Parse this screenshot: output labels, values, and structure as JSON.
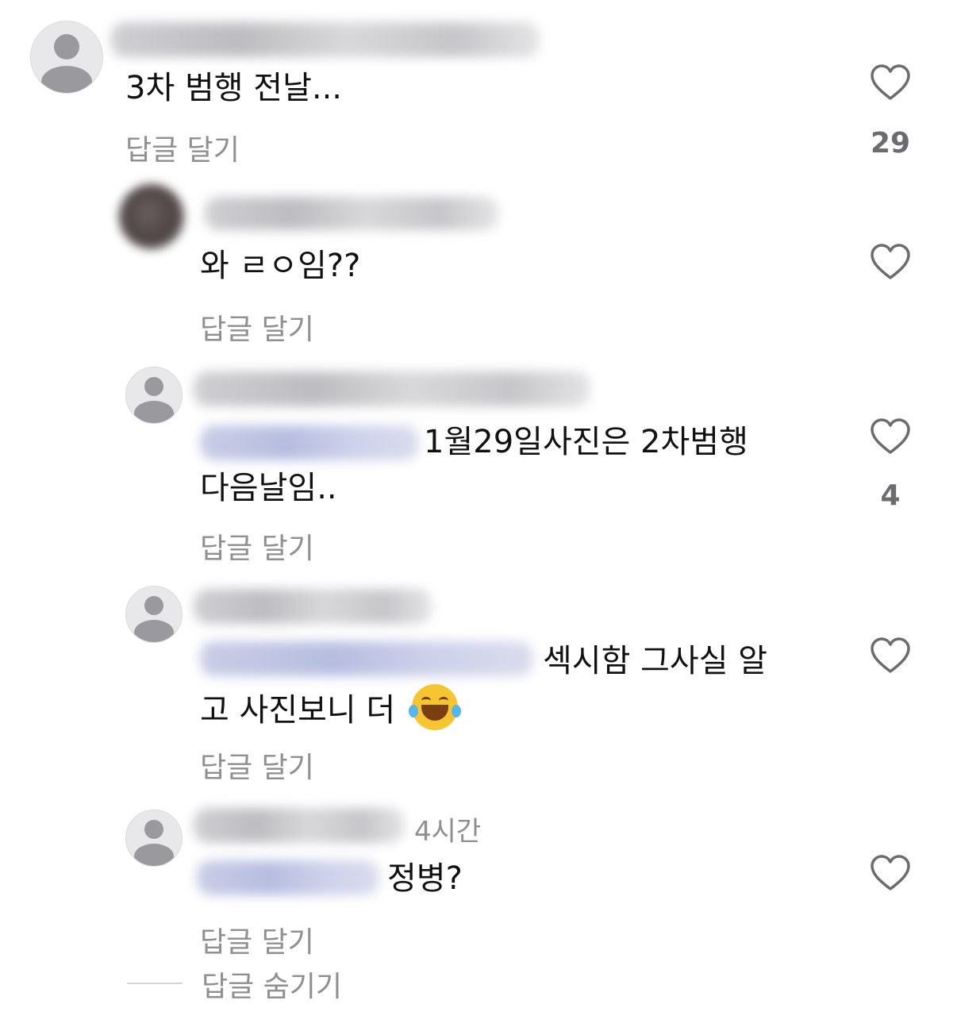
{
  "comments": [
    {
      "text": "3차 범행 전날...",
      "reply_label": "답글 달기",
      "likes": "29",
      "avatar": "default-avatar"
    },
    {
      "text": "와 ㄹㅇ임??",
      "reply_label": "답글 달기",
      "avatar": "photo-avatar"
    },
    {
      "text_line1": "1월29일사진은 2차범행",
      "text_line2": "다음날임..",
      "reply_label": "답글 달기",
      "likes": "4",
      "avatar": "default-avatar"
    },
    {
      "text_line1": "섹시함 그사실 알",
      "text_line2": "고 사진보니 더",
      "emoji": "face-with-tears-of-joy",
      "reply_label": "답글 달기",
      "avatar": "default-avatar"
    },
    {
      "timestamp": "4시간",
      "text": "정병?",
      "reply_label": "답글 달기",
      "avatar": "default-avatar"
    }
  ],
  "hide_replies_label": "답글 숨기기",
  "icons": {
    "like": "heart-outline-icon"
  },
  "colors": {
    "text": "#111111",
    "secondary": "#8e8e93",
    "mention_blur": "#c0c6e4"
  }
}
